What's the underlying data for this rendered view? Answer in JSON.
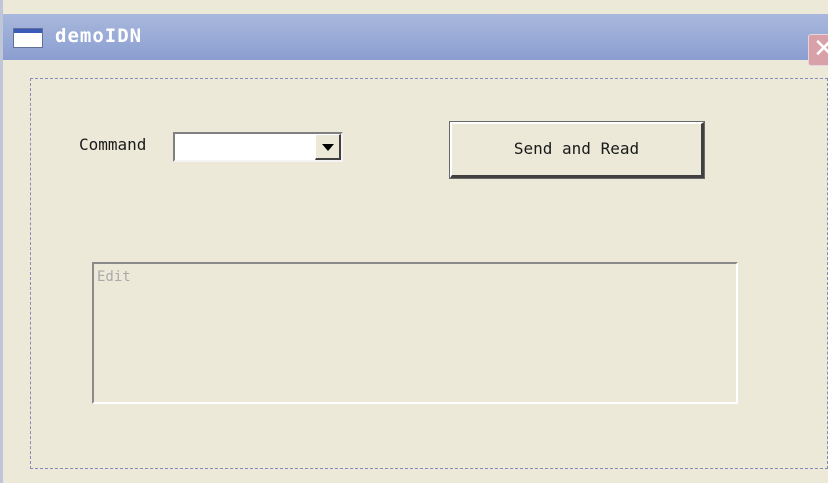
{
  "window": {
    "title": "demoIDN",
    "icon": "app-window-icon",
    "close_glyph": "✕"
  },
  "form": {
    "command_label": "Command",
    "command_value": "",
    "send_button_label": "Send and Read",
    "edit_text": "Edit"
  }
}
